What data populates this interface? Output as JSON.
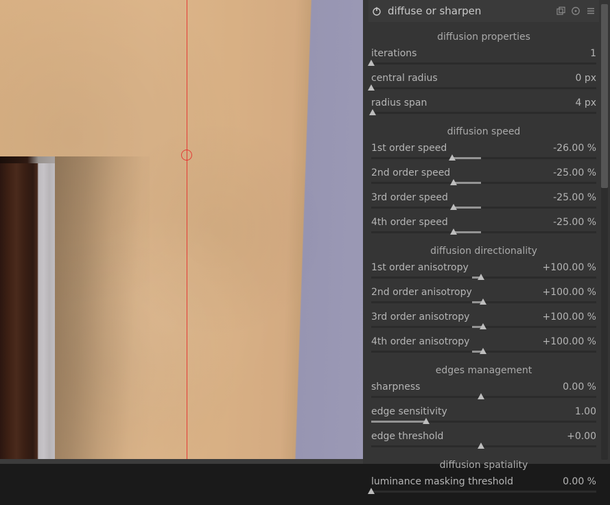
{
  "module": {
    "title": "diffuse or sharpen"
  },
  "sections": {
    "properties": "diffusion properties",
    "speed": "diffusion speed",
    "directionality": "diffusion directionality",
    "edges": "edges management",
    "spatiality": "diffusion spatiality"
  },
  "props": {
    "iterations": {
      "label": "iterations",
      "value": "1",
      "thumb_pct": 0,
      "fill_from": 0,
      "fill_to": 0
    },
    "central_radius": {
      "label": "central radius",
      "value": "0 px",
      "thumb_pct": 0,
      "fill_from": 0,
      "fill_to": 0
    },
    "radius_span": {
      "label": "radius span",
      "value": "4 px",
      "thumb_pct": 0.5,
      "fill_from": 0,
      "fill_to": 0.5
    }
  },
  "speed": {
    "s1": {
      "label": "1st order speed",
      "value": "-26.00 %",
      "thumb_pct": 37,
      "fill_from": 37,
      "fill_to": 50
    },
    "s2": {
      "label": "2nd order speed",
      "value": "-25.00 %",
      "thumb_pct": 37.5,
      "fill_from": 37.5,
      "fill_to": 50
    },
    "s3": {
      "label": "3rd order speed",
      "value": "-25.00 %",
      "thumb_pct": 37.5,
      "fill_from": 37.5,
      "fill_to": 50
    },
    "s4": {
      "label": "4th order speed",
      "value": "-25.00 %",
      "thumb_pct": 37.5,
      "fill_from": 37.5,
      "fill_to": 50
    }
  },
  "aniso": {
    "a1": {
      "label": "1st order anisotropy",
      "value": "+100.00 %",
      "thumb_pct": 50,
      "fill_from": 46,
      "fill_to": 50
    },
    "a2": {
      "label": "2nd order anisotropy",
      "value": "+100.00 %",
      "thumb_pct": 51,
      "fill_from": 46,
      "fill_to": 51
    },
    "a3": {
      "label": "3rd order anisotropy",
      "value": "+100.00 %",
      "thumb_pct": 51,
      "fill_from": 46,
      "fill_to": 51
    },
    "a4": {
      "label": "4th order anisotropy",
      "value": "+100.00 %",
      "thumb_pct": 51,
      "fill_from": 46,
      "fill_to": 51
    }
  },
  "edges": {
    "sharpness": {
      "label": "sharpness",
      "value": "0.00 %",
      "thumb_pct": 50,
      "fill_from": 50,
      "fill_to": 50
    },
    "sensitivity": {
      "label": "edge sensitivity",
      "value": "1.00",
      "thumb_pct": 25,
      "fill_from": 0,
      "fill_to": 25
    },
    "threshold": {
      "label": "edge threshold",
      "value": "+0.00",
      "thumb_pct": 50,
      "fill_from": 50,
      "fill_to": 50
    }
  },
  "spatiality": {
    "lum_mask": {
      "label": "luminance masking threshold",
      "value": "0.00 %",
      "thumb_pct": 0,
      "fill_from": 0,
      "fill_to": 0
    }
  }
}
